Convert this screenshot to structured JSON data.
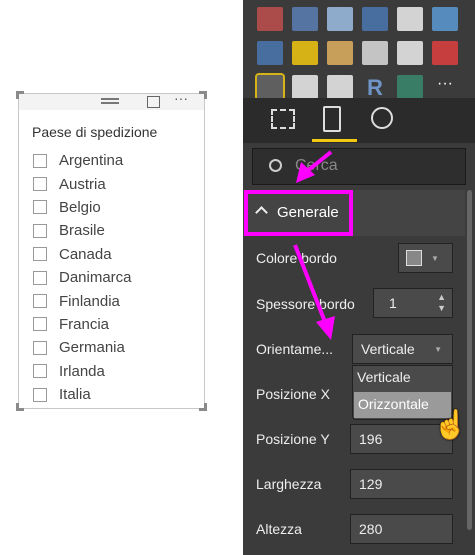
{
  "slicer": {
    "title": "Paese di spedizione",
    "items": [
      "Argentina",
      "Austria",
      "Belgio",
      "Brasile",
      "Canada",
      "Danimarca",
      "Finlandia",
      "Francia",
      "Germania",
      "Irlanda",
      "Italia"
    ]
  },
  "panel": {
    "search_placeholder": "Cerca",
    "section": "Generale",
    "fields": {
      "border_color_label": "Colore bordo",
      "border_color": "#888888",
      "border_width_label": "Spessore bordo",
      "border_width": "1",
      "orientation_label": "Orientame...",
      "orientation": "Verticale",
      "orientation_options": [
        "Verticale",
        "Orizzontale"
      ],
      "pos_x_label": "Posizione X",
      "pos_y_label": "Posizione Y",
      "pos_y": "196",
      "width_label": "Larghezza",
      "width": "129",
      "height_label": "Altezza",
      "height": "280"
    },
    "r_label": "R",
    "accent": "#ff00ff"
  }
}
